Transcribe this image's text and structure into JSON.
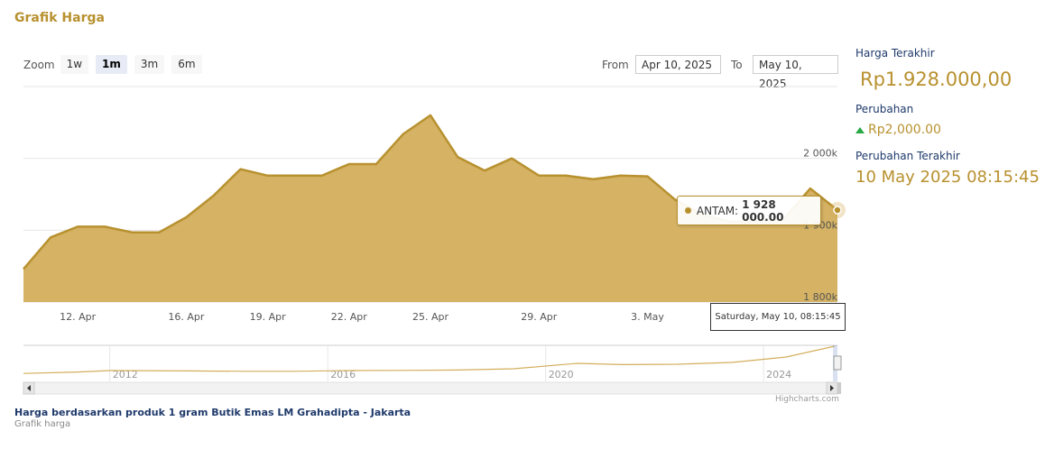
{
  "heading": "Grafik Harga",
  "zoom": {
    "label": "Zoom",
    "buttons": [
      "1w",
      "1m",
      "3m",
      "6m"
    ],
    "active": "1m"
  },
  "range": {
    "from_label": "From",
    "from_value": "Apr 10, 2025",
    "to_label": "To",
    "to_value": "May 10, 2025"
  },
  "tooltip": {
    "series": "ANTAM:",
    "value": "1 928 000.00"
  },
  "date_flag": "Saturday, May 10, 08:15:45",
  "credits": "Highcharts.com",
  "caption": "Harga berdasarkan produk 1 gram Butik Emas LM Grahadipta - Jakarta",
  "subcaption": "Grafik harga",
  "side": {
    "last_price_label": "Harga Terakhir",
    "last_price": "Rp1.928.000,00",
    "change_label": "Perubahan",
    "change": "Rp2,000.00",
    "last_change_label": "Perubahan Terakhir",
    "last_change_time": "10 May 2025 08:15:45"
  },
  "colors": {
    "accent": "#b8912f",
    "area": "#d3ae5c",
    "line": "#b8912f",
    "up": "#27a844",
    "label_navy": "#1f3a6b"
  },
  "chart_data": {
    "type": "area",
    "series": [
      {
        "name": "ANTAM"
      }
    ],
    "x": [
      "2025-04-10",
      "2025-04-11",
      "2025-04-12",
      "2025-04-13",
      "2025-04-14",
      "2025-04-15",
      "2025-04-16",
      "2025-04-17",
      "2025-04-18",
      "2025-04-19",
      "2025-04-20",
      "2025-04-21",
      "2025-04-22",
      "2025-04-23",
      "2025-04-24",
      "2025-04-25",
      "2025-04-26",
      "2025-04-27",
      "2025-04-28",
      "2025-04-29",
      "2025-04-30",
      "2025-05-01",
      "2025-05-02",
      "2025-05-03",
      "2025-05-04",
      "2025-05-05",
      "2025-05-06",
      "2025-05-07",
      "2025-05-08",
      "2025-05-09",
      "2025-05-10"
    ],
    "y": [
      1846000,
      1890000,
      1905000,
      1905000,
      1897000,
      1897000,
      1918000,
      1948000,
      1985000,
      1976000,
      1976000,
      1976000,
      1992000,
      1992000,
      2034000,
      2060000,
      2002000,
      1983000,
      2000000,
      1976000,
      1976000,
      1971000,
      1976000,
      1975000,
      1943000,
      1922000,
      1912000,
      1912000,
      1915000,
      1958000,
      1928000
    ],
    "x_tick_labels": [
      "12. Apr",
      "16. Apr",
      "19. Apr",
      "22. Apr",
      "25. Apr",
      "29. Apr",
      "3. May"
    ],
    "x_tick_dates": [
      "2025-04-12",
      "2025-04-16",
      "2025-04-19",
      "2025-04-22",
      "2025-04-25",
      "2025-04-29",
      "2025-05-03"
    ],
    "y_tick_labels": [
      "1 800k",
      "1 900k",
      "2 000k"
    ],
    "y_ticks": [
      1800000,
      1900000,
      2000000
    ],
    "ylim": [
      1800000,
      2100000
    ],
    "xlim": [
      "2025-04-10",
      "2025-05-10"
    ],
    "grid": true,
    "navigator": {
      "years": [
        "2012",
        "2016",
        "2020",
        "2024"
      ],
      "year_dates": [
        "2012-01-01",
        "2016-01-01",
        "2020-01-01",
        "2024-01-01"
      ],
      "xlim": [
        "2010-06-01",
        "2025-05-10"
      ],
      "x": [
        "2010-06-01",
        "2011-06-01",
        "2012-01-01",
        "2013-06-01",
        "2014-06-01",
        "2015-06-01",
        "2016-06-01",
        "2017-06-01",
        "2018-06-01",
        "2019-06-01",
        "2020-08-01",
        "2021-06-01",
        "2022-06-01",
        "2023-06-01",
        "2024-06-01",
        "2025-04-20"
      ],
      "y": [
        440000,
        520000,
        600000,
        580000,
        560000,
        560000,
        600000,
        610000,
        630000,
        700000,
        1000000,
        930000,
        950000,
        1050000,
        1350000,
        1950000
      ],
      "ylim": [
        0,
        2000000
      ]
    }
  }
}
